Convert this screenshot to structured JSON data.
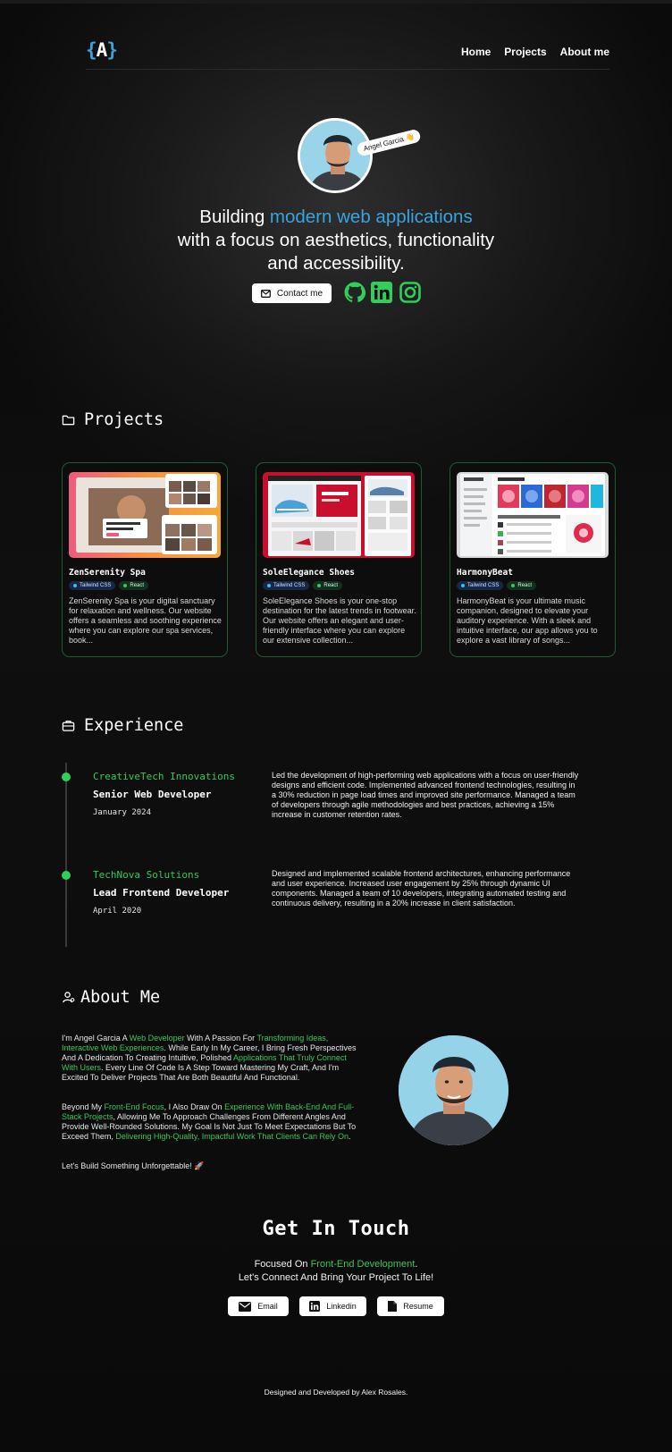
{
  "header": {
    "logo_brace_open": "{",
    "logo_letter": "A",
    "logo_brace_close": "}",
    "nav": [
      "Home",
      "Projects",
      "About me"
    ]
  },
  "hero": {
    "name_tag": "Angel Garcia 👋",
    "title_pre": "Building ",
    "title_accent": "modern web applications",
    "title_line2": "with a focus on aesthetics, functionality",
    "title_line3": "and accessibility.",
    "contact_label": "Contact me",
    "social_icons": [
      "github-icon",
      "linkedin-icon",
      "instagram-icon"
    ]
  },
  "projects": {
    "heading": "Projects",
    "cards": [
      {
        "title": "ZenSerenity Spa",
        "tags": [
          "Tailwind CSS",
          "React"
        ],
        "desc": "ZenSerenity Spa is your digital sanctuary for relaxation and wellness. Our website offers a seamless and soothing experience where you can explore our spa services, book..."
      },
      {
        "title": "SoleElegance Shoes",
        "tags": [
          "Tailwind CSS",
          "React"
        ],
        "desc": "SoleElegance Shoes is your one-stop destination for the latest trends in footwear. Our website offers an elegant and user-friendly interface where you can explore our extensive collection..."
      },
      {
        "title": "HarmonyBeat",
        "tags": [
          "Tailwind CSS",
          "React"
        ],
        "desc": "HarmonyBeat is your ultimate music companion, designed to elevate your auditory experience. With a sleek and intuitive interface, our app allows you to explore a vast library of songs..."
      }
    ]
  },
  "experience": {
    "heading": "Experience",
    "items": [
      {
        "company": "CreativeTech Innovations",
        "role": "Senior Web Developer",
        "date": "January 2024",
        "desc": "Led the development of high-performing web applications with a focus on user-friendly designs and efficient code. Implemented advanced frontend technologies, resulting in a 30% reduction in page load times and improved site performance. Managed a team of developers through agile methodologies and best practices, achieving a 15% increase in customer retention rates."
      },
      {
        "company": "TechNova Solutions",
        "role": "Lead Frontend Developer",
        "date": "April 2020",
        "desc": "Designed and implemented scalable frontend architectures, enhancing performance and user experience. Increased user engagement by 25% through dynamic UI components. Managed a team of 10 developers, integrating automated testing and continuous delivery, resulting in a 20% increase in client satisfaction."
      }
    ]
  },
  "about": {
    "heading": "About Me",
    "p1": [
      {
        "t": "I'm Angel Garcia A ",
        "g": false
      },
      {
        "t": "Web Developer",
        "g": true
      },
      {
        "t": " With A Passion For ",
        "g": false
      },
      {
        "t": "Transforming Ideas, Interactive Web Experiences",
        "g": true
      },
      {
        "t": ". While Early In My Career, I Bring Fresh Perspectives And A Dedication To Creating Intuitive, Polished ",
        "g": false
      },
      {
        "t": "Applications That Truly Connect With Users",
        "g": true
      },
      {
        "t": ". Every Line Of Code Is A Step Toward Mastering My Craft, And I'm Excited To Deliver Projects That Are Both Beautiful And Functional.",
        "g": false
      }
    ],
    "p2": [
      {
        "t": "Beyond My ",
        "g": false
      },
      {
        "t": "Front-End Focus",
        "g": true
      },
      {
        "t": ", I Also Draw On ",
        "g": false
      },
      {
        "t": "Experience With Back-End And Full-Stack Projects",
        "g": true
      },
      {
        "t": ", Allowing Me To Approach Challenges From Different Angles And Provide Well-Rounded Solutions. My Goal Is Not Just To Meet Expectations But To Exceed Them, ",
        "g": false
      },
      {
        "t": "Delivering High-Quality, Impactful Work That Clients Can Rely On",
        "g": true
      },
      {
        "t": ".",
        "g": false
      }
    ],
    "p3": "Let's Build Something Unforgettable! 🚀"
  },
  "contact": {
    "heading": "Get In Touch",
    "sub1_pre": "Focused On ",
    "sub1_accent": "Front-End Development",
    "sub1_post": ".",
    "sub2": "Let's Connect And Bring Your Project To Life!",
    "buttons": [
      "Email",
      "Linkedin",
      "Resume"
    ]
  },
  "footer": {
    "text": "Designed and Developed by Alex Rosales."
  },
  "colors": {
    "accent_blue": "#3aa3dc",
    "accent_green": "#35c85e",
    "background": "#0b0b0b"
  }
}
